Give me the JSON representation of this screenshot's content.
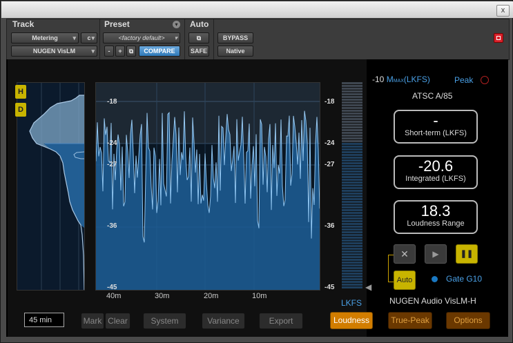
{
  "window": {
    "close_glyph": "x"
  },
  "ptbar": {
    "track_header": "Track",
    "preset_header": "Preset",
    "auto_header": "Auto",
    "track_select": "Metering",
    "channel_select": "c",
    "plugin_select": "NUGEN VisLM",
    "preset_select": "<factory default>",
    "minus": "-",
    "plus": "+",
    "compare": "COMPARE",
    "safe": "SAFE",
    "bypass": "BYPASS",
    "native": "Native"
  },
  "graph": {
    "y_ticks": [
      "-18",
      "-24",
      "-27",
      "-36",
      "-45"
    ],
    "x_ticks": [
      "40m",
      "30m",
      "20m",
      "10m"
    ]
  },
  "meter": {
    "unit": "LKFS"
  },
  "readouts": {
    "scale_value": "-10",
    "scale_m": "M",
    "scale_sub": "MAX",
    "scale_unit": "(LKFS)",
    "peak_label": "Peak",
    "standard": "ATSC A/85",
    "short_term_value": "-",
    "short_term_label": "Short-term (LKFS)",
    "integrated_value": "-20.6",
    "integrated_label": "Integrated (LKFS)",
    "range_value": "18.3",
    "range_label": "Loudness Range"
  },
  "transport": {
    "reset_glyph": "✕",
    "play_glyph": "▶",
    "pause_glyph": "❚❚",
    "auto_label": "Auto",
    "gate_label": "Gate G10"
  },
  "histogram": {
    "h_label": "H",
    "d_label": "D"
  },
  "brand": "NUGEN Audio VisLM-H",
  "bottom": {
    "duration_value": "45 min",
    "mark": "Mark",
    "clear": "Clear",
    "system": "System",
    "variance": "Variance",
    "export": "Export",
    "loudness": "Loudness",
    "true_peak": "True-Peak",
    "options": "Options"
  },
  "colors": {
    "accent_yellow": "#c8b400",
    "accent_blue": "#1a78c2",
    "tab_orange": "#d27d00",
    "tab_brown": "#6a3800"
  }
}
